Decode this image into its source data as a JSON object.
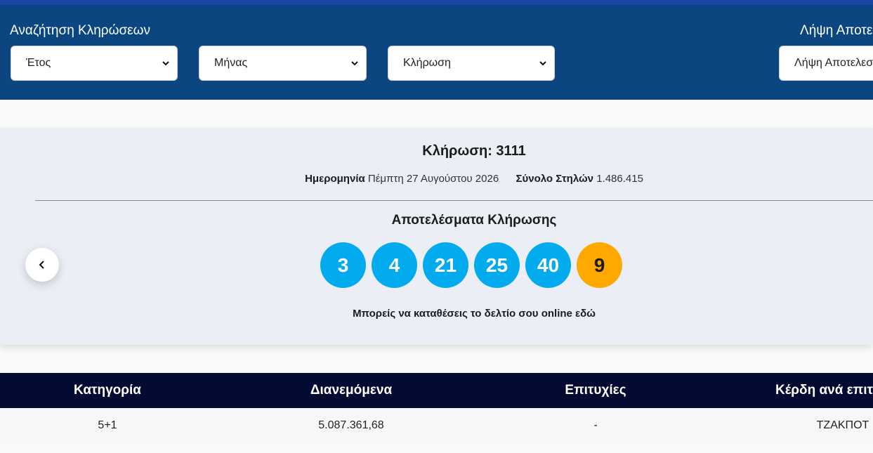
{
  "search": {
    "title": "Αναζήτηση Κληρώσεων",
    "year_select": "Έτος",
    "month_select": "Μήνας",
    "draw_select": "Κλήρωση"
  },
  "fetch": {
    "title": "Λήψη Αποτε",
    "select": "Λήψη Αποτελεσ"
  },
  "draw": {
    "title": "Κλήρωση: 3111",
    "date_label": "Ημερομηνία",
    "date_value": "Πέμπτη 27 Αυγούστου 2026",
    "columns_label": "Σύνολο Στηλών",
    "columns_value": "1.486.415",
    "results_title": "Αποτελέσματα Κλήρωσης",
    "numbers": [
      "3",
      "4",
      "21",
      "25",
      "40"
    ],
    "bonus": "9",
    "online_text": "Μπορείς να καταθέσεις το δελτίο σου online εδώ"
  },
  "table": {
    "headers": [
      "Κατηγορία",
      "Διανεμόμενα",
      "Επιτυχίες",
      "Κέρδη ανά επιτ"
    ],
    "rows": [
      [
        "5+1",
        "5.087.361,68",
        "-",
        "ΤΖΑΚΠΟΤ"
      ]
    ]
  },
  "colors": {
    "header_bg": "#0b4680",
    "ball": "#02abee",
    "bonus_ball": "#ffa800",
    "table_head": "#030b33"
  },
  "icons": {
    "select_arrow": "chevron-down-icon",
    "prev": "chevron-left-icon"
  }
}
